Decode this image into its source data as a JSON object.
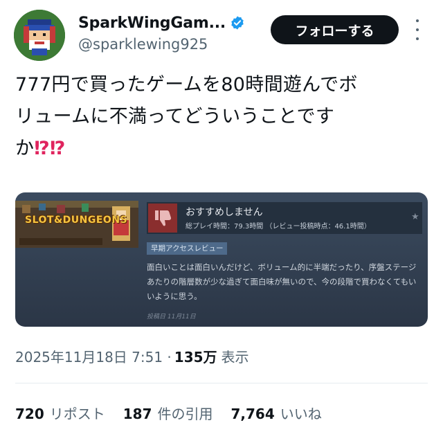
{
  "author": {
    "display_name": "SparkWingGam...",
    "handle": "@sparklewing925",
    "verified": true
  },
  "follow_label": "フォローする",
  "tweet": {
    "line1": "777円で買ったゲームを80時間遊んでボ",
    "line2": "リュームに不満ってどういうことです",
    "line3": "か",
    "emoji": "⁉⁉"
  },
  "review_card": {
    "game_title": "SLOT&DUNGEONS",
    "verdict": "おすすめしません",
    "hours": "総プレイ時間：79.3時間 （レビュー投稿時点：46.1時間）",
    "early_access": "早期アクセスレビュー",
    "body": "面白いことは面白いんだけど、ボリューム的に半端だったり、序盤ステージあたりの階層数が少な過ぎて面白味が無いので、今の段階で買わなくてもいいように思う。",
    "posted": "投稿日 11月11日"
  },
  "meta": {
    "timestamp": "2025年11月18日 7:51 ·",
    "views_count": "135万",
    "views_label": "表示"
  },
  "stats": [
    {
      "count": "720",
      "label": "リポスト"
    },
    {
      "count": "187",
      "label": "件の引用"
    },
    {
      "count": "7,764",
      "label": "いいね"
    }
  ],
  "colors": {
    "verified_blue": "#1d9bf0",
    "follow_bg": "#0f1419",
    "review_card_bg": "#3b4b5f",
    "thumbs_down_red": "#8a2e2e"
  }
}
